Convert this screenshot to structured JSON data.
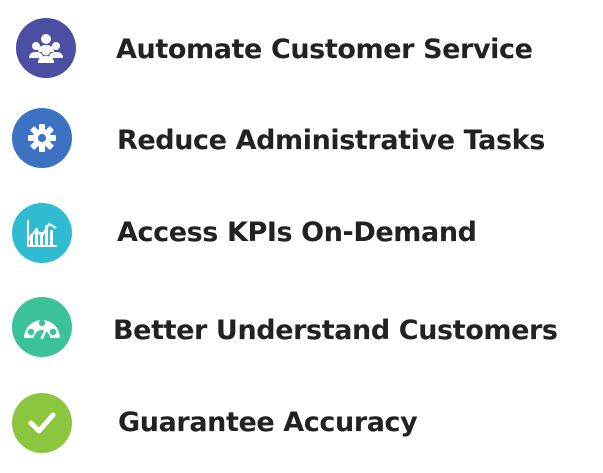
{
  "items": [
    {
      "label": "Automate Customer Service",
      "icon": "users-group-icon",
      "color": "#4a4fa3"
    },
    {
      "label": "Reduce Administrative Tasks",
      "icon": "gear-icon",
      "color": "#3b73c2"
    },
    {
      "label": "Access KPIs On-Demand",
      "icon": "chart-analytics-icon",
      "color": "#2fbcd3"
    },
    {
      "label": "Better Understand Customers",
      "icon": "satisfaction-gauge-icon",
      "color": "#3cc29a"
    },
    {
      "label": "Guarantee Accuracy",
      "icon": "checkmark-icon",
      "color": "#8cc63e"
    }
  ]
}
